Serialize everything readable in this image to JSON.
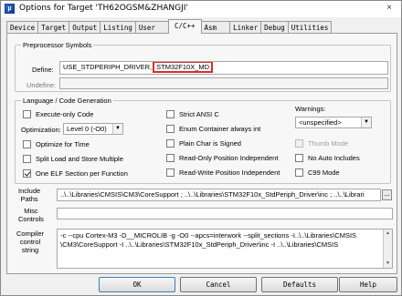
{
  "window": {
    "title": "Options for Target 'TH62OGSM&ZHANGJI'",
    "close_label": "×",
    "icon_label": "µ"
  },
  "tabs": [
    "Device",
    "Target",
    "Output",
    "Listing",
    "User",
    "C/C++",
    "Asm",
    "Linker",
    "Debug",
    "Utilities"
  ],
  "active_tab": "C/C++",
  "preprocessor": {
    "legend": "Preprocessor Symbols",
    "define_label": "Define:",
    "define_value_prefix": "USE_STDPERIPH_DRIVER,",
    "define_value_highlight": "STM32F10X_MD",
    "undefine_label": "Undefine:",
    "undefine_value": ""
  },
  "language": {
    "legend": "Language / Code Generation",
    "execute_only": {
      "label": "Execute-only Code",
      "checked": false
    },
    "optimization_label": "Optimization:",
    "optimization_value": "Level 0 (-O0)",
    "optimize_time": {
      "label": "Optimize for Time",
      "checked": false
    },
    "split_load_store": {
      "label": "Split Load and Store Multiple",
      "checked": false
    },
    "one_elf": {
      "label": "One ELF Section per Function",
      "checked": true
    },
    "strict_ansi": {
      "label": "Strict ANSI C",
      "checked": false
    },
    "enum_container": {
      "label": "Enum Container always int",
      "checked": false
    },
    "plain_char": {
      "label": "Plain Char is Signed",
      "checked": false
    },
    "readonly_pi": {
      "label": "Read-Only Position Independent",
      "checked": false
    },
    "readwrite_pi": {
      "label": "Read-Write Position Independent",
      "checked": false
    },
    "warnings_label": "Warnings:",
    "warnings_value": "<unspecified>",
    "thumb_mode": {
      "label": "Thumb Mode",
      "checked": false,
      "disabled": true
    },
    "no_auto_includes": {
      "label": "No Auto Includes",
      "checked": false
    },
    "c99_mode": {
      "label": "C99 Mode",
      "checked": false
    }
  },
  "paths": {
    "include_label": "Include\nPaths",
    "include_value": "..\\..\\Libraries\\CMSIS\\CM3\\CoreSupport ; ..\\..\\Libraries\\STM32F10x_StdPeriph_Driver\\inc ; ..\\..\\Librari",
    "browse_label": "...",
    "misc_label": "Misc\nControls",
    "misc_value": "",
    "compiler_label": "Compiler\ncontrol\nstring",
    "compiler_value_line1": "-c --cpu Cortex-M3 -D__MICROLIB -g -O0 --apcs=interwork --split_sections -I..\\..\\Libraries\\CMSIS",
    "compiler_value_line2": "\\CM3\\CoreSupport -I ..\\..\\Libraries\\STM32F10x_StdPeriph_Driver\\inc -I ..\\..\\Libraries\\CMSIS"
  },
  "buttons": {
    "ok": "OK",
    "cancel": "Cancel",
    "defaults": "Defaults",
    "help": "Help"
  }
}
